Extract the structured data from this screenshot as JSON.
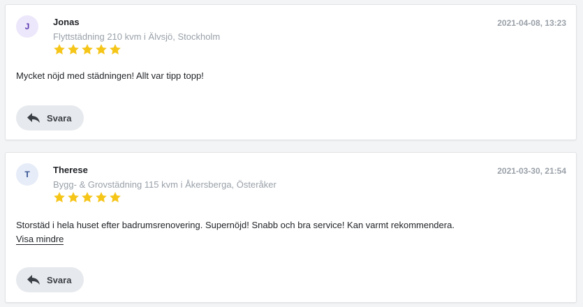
{
  "colors": {
    "star": "#f5c518",
    "page_background": "#f3f4f6",
    "button_background": "#e6e9ed"
  },
  "reviews": [
    {
      "avatar_initial": "J",
      "name": "Jonas",
      "service": "Flyttstädning 210 kvm i Älvsjö, Stockholm",
      "rating": 5,
      "date": "2021-04-08, 13:23",
      "text": "Mycket nöjd med städningen! Allt var tipp topp!",
      "reply_label": "Svara",
      "reply_icon": "reply-arrow-icon"
    },
    {
      "avatar_initial": "T",
      "name": "Therese",
      "service": "Bygg- & Grovstädning 115 kvm i Åkersberga, Österåker",
      "rating": 5,
      "date": "2021-03-30, 21:54",
      "text": "Storstäd i hela huset efter badrumsrenovering. Supernöjd! Snabb och bra service! Kan varmt rekommendera.",
      "toggle_label": "Visa mindre",
      "reply_label": "Svara",
      "reply_icon": "reply-arrow-icon"
    }
  ]
}
